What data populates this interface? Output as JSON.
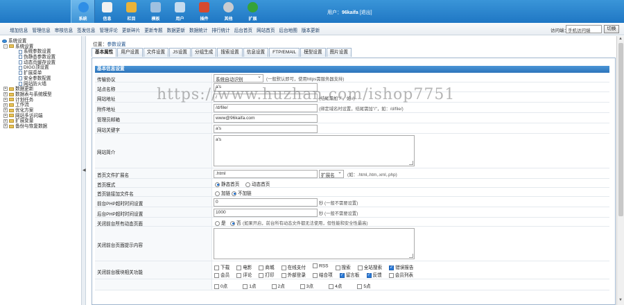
{
  "top_nav": [
    {
      "label": "系统",
      "icon": "globe-icon",
      "color": "#2f8ee6"
    },
    {
      "label": "信息",
      "icon": "edit-icon",
      "color": "#f1f1f1"
    },
    {
      "label": "栏目",
      "icon": "folder-icon",
      "color": "#e9b33a"
    },
    {
      "label": "模板",
      "icon": "template-icon",
      "color": "#9fc0e0"
    },
    {
      "label": "用户",
      "icon": "user-icon",
      "color": "#c6dcef"
    },
    {
      "label": "插件",
      "icon": "plugin-icon",
      "color": "#d64a2f"
    },
    {
      "label": "其他",
      "icon": "gear-icon",
      "color": "#c9ccd0"
    },
    {
      "label": "扩展",
      "icon": "plus-icon",
      "color": "#35a23a"
    }
  ],
  "user": {
    "prefix": "用户：",
    "name": "96kaifa",
    "logout": "[退出]"
  },
  "menu": [
    "增加信息",
    "管理信息",
    "审核信息",
    "签发信息",
    "管理评论",
    "更新碎片",
    "更新专题",
    "数据更新",
    "数据统计",
    "排行统计",
    "后台首页",
    "网站首页",
    "后台地图",
    "版本更新"
  ],
  "visit": {
    "label": "访问端：",
    "selected": "手机访问端",
    "switch": "切换"
  },
  "tree": [
    {
      "level": 0,
      "type": "root",
      "label": "系统设置"
    },
    {
      "level": 1,
      "type": "folder",
      "label": "系统设置",
      "toggle": "-"
    },
    {
      "level": 2,
      "type": "page",
      "label": "系统参数设置"
    },
    {
      "level": 2,
      "type": "page",
      "label": "伪静态参数设置"
    },
    {
      "level": 2,
      "type": "page",
      "label": "动态页缓存设置"
    },
    {
      "level": 2,
      "type": "page",
      "label": "DIGG顶设置"
    },
    {
      "level": 2,
      "type": "page",
      "label": "扩展菜单"
    },
    {
      "level": 2,
      "type": "page",
      "label": "安全参数配置"
    },
    {
      "level": 2,
      "type": "page",
      "label": "网站防火墙"
    },
    {
      "level": 1,
      "type": "folder",
      "label": "数据更新",
      "toggle": "+"
    },
    {
      "level": 1,
      "type": "folder",
      "label": "数据表与系统模型",
      "toggle": "+"
    },
    {
      "level": 1,
      "type": "folder",
      "label": "计划任务",
      "toggle": "+"
    },
    {
      "level": 1,
      "type": "folder",
      "label": "工作流",
      "toggle": "+"
    },
    {
      "level": 1,
      "type": "folder",
      "label": "优化方案",
      "toggle": "+"
    },
    {
      "level": 1,
      "type": "folder",
      "label": "网站多访问端",
      "toggle": "+"
    },
    {
      "level": 1,
      "type": "folder",
      "label": "扩展变量",
      "toggle": "+"
    },
    {
      "level": 1,
      "type": "folder",
      "label": "备份与恢复数据",
      "toggle": "+"
    }
  ],
  "breadcrumb": {
    "prefix": "位置：",
    "current": "参数设置"
  },
  "tabs": [
    "基本属性",
    "用户设置",
    "文件设置",
    "JS设置",
    "分组生成",
    "搜索设置",
    "信息设置",
    "FTP/EMAIL",
    "模型设置",
    "图片设置"
  ],
  "panel_title": "基本信息设置",
  "form": {
    "protocol": {
      "label": "传输协议",
      "value": "系统自动识别",
      "hint": "(一般默认即可，使用https需服务器支持)"
    },
    "site_name": {
      "label": "站点名称",
      "value": "a's"
    },
    "site_url": {
      "label": "网站地址",
      "value": "/",
      "hint": "(结尾需加\"/\"，如:/)"
    },
    "attach_url": {
      "label": "附件地址",
      "value": "/d/file/",
      "hint": "(绑定域名时设置，结尾需加\"/\"，如：/d/file/)"
    },
    "admin_email": {
      "label": "管理员邮箱",
      "value": "www@96kaifa.com"
    },
    "keywords": {
      "label": "网站关键字",
      "value": "a's"
    },
    "intro": {
      "label": "网站简介",
      "value": "a's"
    },
    "index_ext": {
      "label": "首页文件扩展名",
      "value": ".html",
      "select": "扩展名",
      "hint": "(如：.html,.htm,.xml,.php)"
    },
    "index_mode": {
      "label": "首页模式",
      "options": [
        "静态首页",
        "动态首页"
      ],
      "selected": 0
    },
    "index_name": {
      "label": "首页链接加文件名",
      "options": [
        "加链",
        "不加链"
      ],
      "selected": 1
    },
    "front_php_time": {
      "label": "前台PHP超时时间设置",
      "value": "0",
      "hint": "秒 (一般不需要设置)"
    },
    "back_php_time": {
      "label": "后台PHP超时时间设置",
      "value": "1000",
      "hint": "秒 (一般不需要设置)"
    },
    "close_dynamic": {
      "label": "关闭前台所有动态页面",
      "options": [
        "是",
        "否"
      ],
      "selected": 1,
      "hint": "(如果开启，前台所有动态文件都无法使用，但性能和安全性最高)"
    },
    "close_tip": {
      "label": "关闭前台页面提示内容",
      "value": ""
    },
    "close_modules": {
      "label": "关闭前台模块相关功能",
      "line1": [
        {
          "t": "下载",
          "c": false
        },
        {
          "t": "电影",
          "c": false
        },
        {
          "t": "商城",
          "c": false
        },
        {
          "t": "在线支付",
          "c": false
        },
        {
          "t": "RSS",
          "c": false
        },
        {
          "t": "搜索",
          "c": false
        },
        {
          "t": "全站搜索",
          "c": false
        },
        {
          "t": "错误报告",
          "c": true
        }
      ],
      "line2": [
        {
          "t": "会员",
          "c": false
        },
        {
          "t": "评论",
          "c": false
        },
        {
          "t": "打印",
          "c": false
        },
        {
          "t": "外部登录",
          "c": false
        },
        {
          "t": "结合项",
          "c": false
        },
        {
          "t": "留言板",
          "c": true
        },
        {
          "t": "反馈",
          "c": true
        },
        {
          "t": "会员列表",
          "c": false
        }
      ]
    },
    "last_row": [
      {
        "t": "0点",
        "c": false
      },
      {
        "t": "1点",
        "c": false
      },
      {
        "t": "2点",
        "c": false
      },
      {
        "t": "3点",
        "c": false
      },
      {
        "t": "4点",
        "c": false
      },
      {
        "t": "5点",
        "c": false
      }
    ]
  },
  "watermark": "https://www.huzhan.com/ishop7751"
}
